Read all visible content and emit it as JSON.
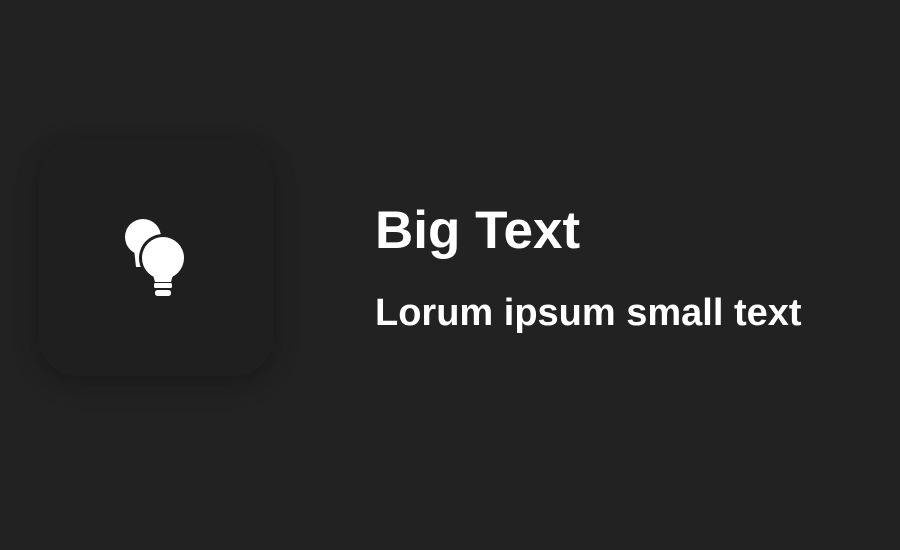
{
  "app_icon": {
    "icon_name": "lightbulbs-icon",
    "tile_color": "#1f1f1f",
    "glyph_color": "#ffffff"
  },
  "content": {
    "title": "Big Text",
    "subtitle": "Lorum ipsum small text"
  },
  "colors": {
    "background": "#222222",
    "text": "#ffffff"
  }
}
